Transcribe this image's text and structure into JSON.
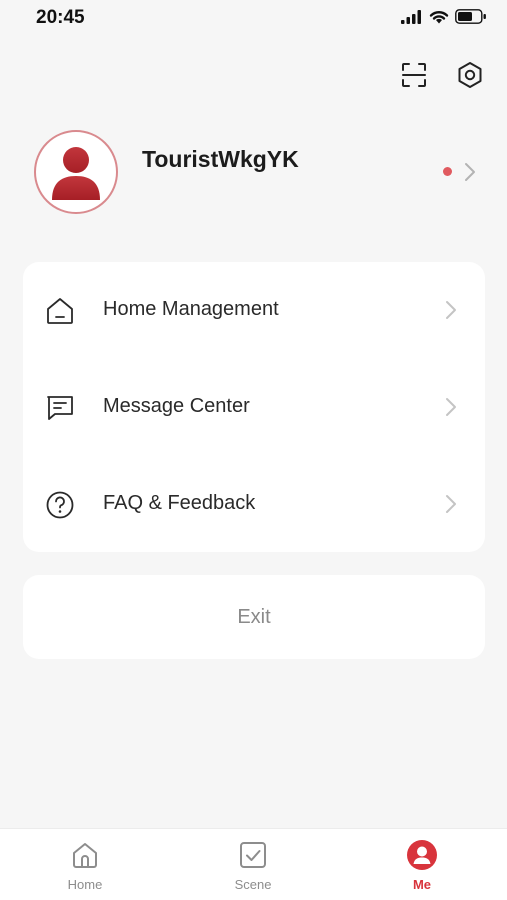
{
  "status_bar": {
    "time": "20:45"
  },
  "profile": {
    "username": "TouristWkgYK"
  },
  "menu": {
    "items": [
      {
        "label": "Home Management",
        "icon": "house-icon"
      },
      {
        "label": "Message Center",
        "icon": "message-icon"
      },
      {
        "label": "FAQ & Feedback",
        "icon": "question-icon"
      }
    ]
  },
  "exit": {
    "label": "Exit"
  },
  "tabbar": {
    "tabs": [
      {
        "label": "Home",
        "icon": "home-icon",
        "active": false
      },
      {
        "label": "Scene",
        "icon": "scene-icon",
        "active": false
      },
      {
        "label": "Me",
        "icon": "me-icon",
        "active": true
      }
    ]
  },
  "colors": {
    "accent": "#d8343c",
    "background": "#f6f6f6",
    "card": "#ffffff",
    "muted": "#8d8d8d"
  }
}
